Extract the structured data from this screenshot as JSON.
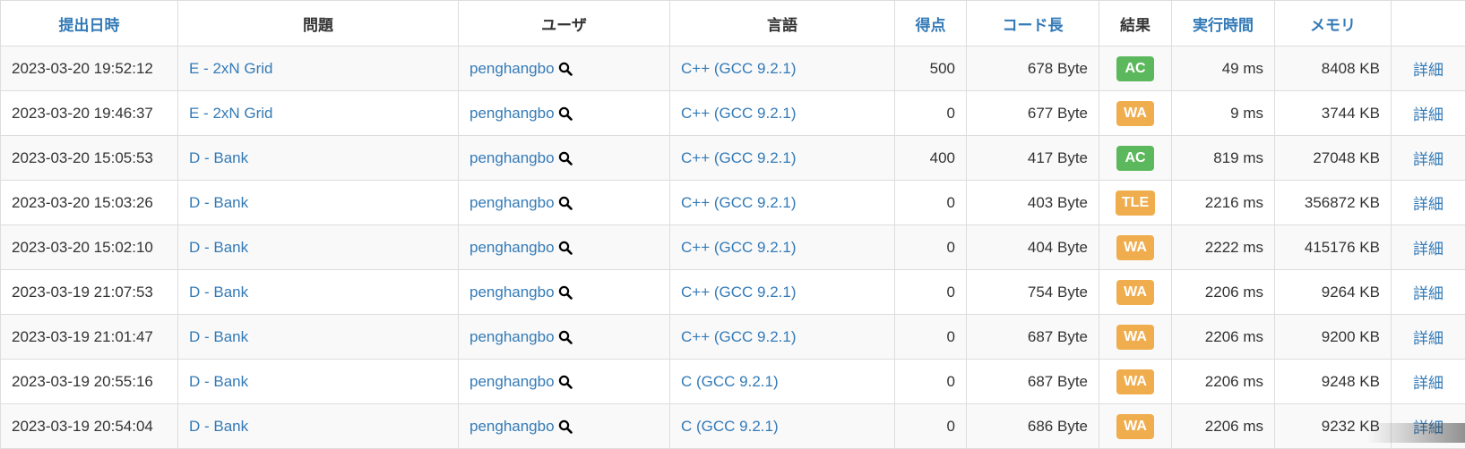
{
  "columns": {
    "submit_time": "提出日時",
    "task": "問題",
    "user": "ユーザ",
    "language": "言語",
    "score": "得点",
    "code_length": "コード長",
    "status": "結果",
    "exec_time": "実行時間",
    "memory": "メモリ",
    "detail": ""
  },
  "rows": [
    {
      "time": "2023-03-20 19:52:12",
      "task": "E - 2xN Grid",
      "user": "penghangbo",
      "language": "C++ (GCC 9.2.1)",
      "score": "500",
      "code_length": "678 Byte",
      "status": "AC",
      "exec_time": "49 ms",
      "memory": "8408 KB",
      "detail": "詳細"
    },
    {
      "time": "2023-03-20 19:46:37",
      "task": "E - 2xN Grid",
      "user": "penghangbo",
      "language": "C++ (GCC 9.2.1)",
      "score": "0",
      "code_length": "677 Byte",
      "status": "WA",
      "exec_time": "9 ms",
      "memory": "3744 KB",
      "detail": "詳細"
    },
    {
      "time": "2023-03-20 15:05:53",
      "task": "D - Bank",
      "user": "penghangbo",
      "language": "C++ (GCC 9.2.1)",
      "score": "400",
      "code_length": "417 Byte",
      "status": "AC",
      "exec_time": "819 ms",
      "memory": "27048 KB",
      "detail": "詳細"
    },
    {
      "time": "2023-03-20 15:03:26",
      "task": "D - Bank",
      "user": "penghangbo",
      "language": "C++ (GCC 9.2.1)",
      "score": "0",
      "code_length": "403 Byte",
      "status": "TLE",
      "exec_time": "2216 ms",
      "memory": "356872 KB",
      "detail": "詳細"
    },
    {
      "time": "2023-03-20 15:02:10",
      "task": "D - Bank",
      "user": "penghangbo",
      "language": "C++ (GCC 9.2.1)",
      "score": "0",
      "code_length": "404 Byte",
      "status": "WA",
      "exec_time": "2222 ms",
      "memory": "415176 KB",
      "detail": "詳細"
    },
    {
      "time": "2023-03-19 21:07:53",
      "task": "D - Bank",
      "user": "penghangbo",
      "language": "C++ (GCC 9.2.1)",
      "score": "0",
      "code_length": "754 Byte",
      "status": "WA",
      "exec_time": "2206 ms",
      "memory": "9264 KB",
      "detail": "詳細"
    },
    {
      "time": "2023-03-19 21:01:47",
      "task": "D - Bank",
      "user": "penghangbo",
      "language": "C++ (GCC 9.2.1)",
      "score": "0",
      "code_length": "687 Byte",
      "status": "WA",
      "exec_time": "2206 ms",
      "memory": "9200 KB",
      "detail": "詳細"
    },
    {
      "time": "2023-03-19 20:55:16",
      "task": "D - Bank",
      "user": "penghangbo",
      "language": "C (GCC 9.2.1)",
      "score": "0",
      "code_length": "687 Byte",
      "status": "WA",
      "exec_time": "2206 ms",
      "memory": "9248 KB",
      "detail": "詳細"
    },
    {
      "time": "2023-03-19 20:54:04",
      "task": "D - Bank",
      "user": "penghangbo",
      "language": "C (GCC 9.2.1)",
      "score": "0",
      "code_length": "686 Byte",
      "status": "WA",
      "exec_time": "2206 ms",
      "memory": "9232 KB",
      "detail": "詳細"
    }
  ],
  "colors": {
    "link": "#337ab7",
    "ac_badge": "#5cb85c",
    "wa_badge": "#f0ad4e",
    "tle_badge": "#f0ad4e",
    "border": "#dddddd",
    "stripe": "#f9f9f9"
  },
  "icons": {
    "user_search": "search-icon"
  }
}
